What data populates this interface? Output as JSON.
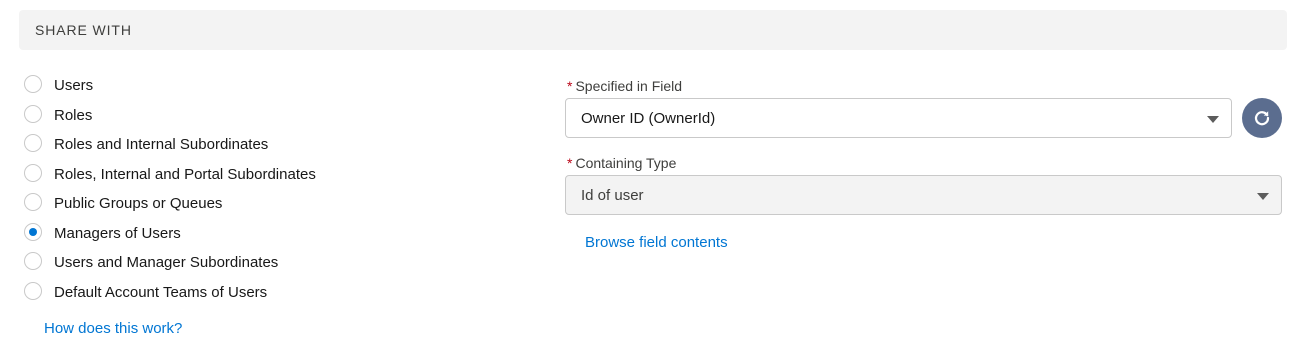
{
  "section": {
    "title": "SHARE WITH"
  },
  "share_options": [
    {
      "label": "Users",
      "checked": false
    },
    {
      "label": "Roles",
      "checked": false
    },
    {
      "label": "Roles and Internal Subordinates",
      "checked": false
    },
    {
      "label": "Roles, Internal and Portal Subordinates",
      "checked": false
    },
    {
      "label": "Public Groups or Queues",
      "checked": false
    },
    {
      "label": "Managers of Users",
      "checked": true
    },
    {
      "label": "Users and Manager Subordinates",
      "checked": false
    },
    {
      "label": "Default Account Teams of Users",
      "checked": false
    }
  ],
  "help_link": "How does this work?",
  "specified_field": {
    "required_marker": "*",
    "label": "Specified in Field",
    "value": "Owner ID (OwnerId)"
  },
  "containing_type": {
    "required_marker": "*",
    "label": "Containing Type",
    "value": "Id of user",
    "disabled": true
  },
  "browse_link": "Browse field contents",
  "icons": {
    "refresh": "refresh-icon",
    "caret": "chevron-down-icon"
  },
  "colors": {
    "accent": "#0176d3",
    "required": "#ba0517",
    "refresh_button": "#5b6d8f",
    "header_bg": "#f3f3f3",
    "disabled_bg": "#f3f3f3"
  }
}
